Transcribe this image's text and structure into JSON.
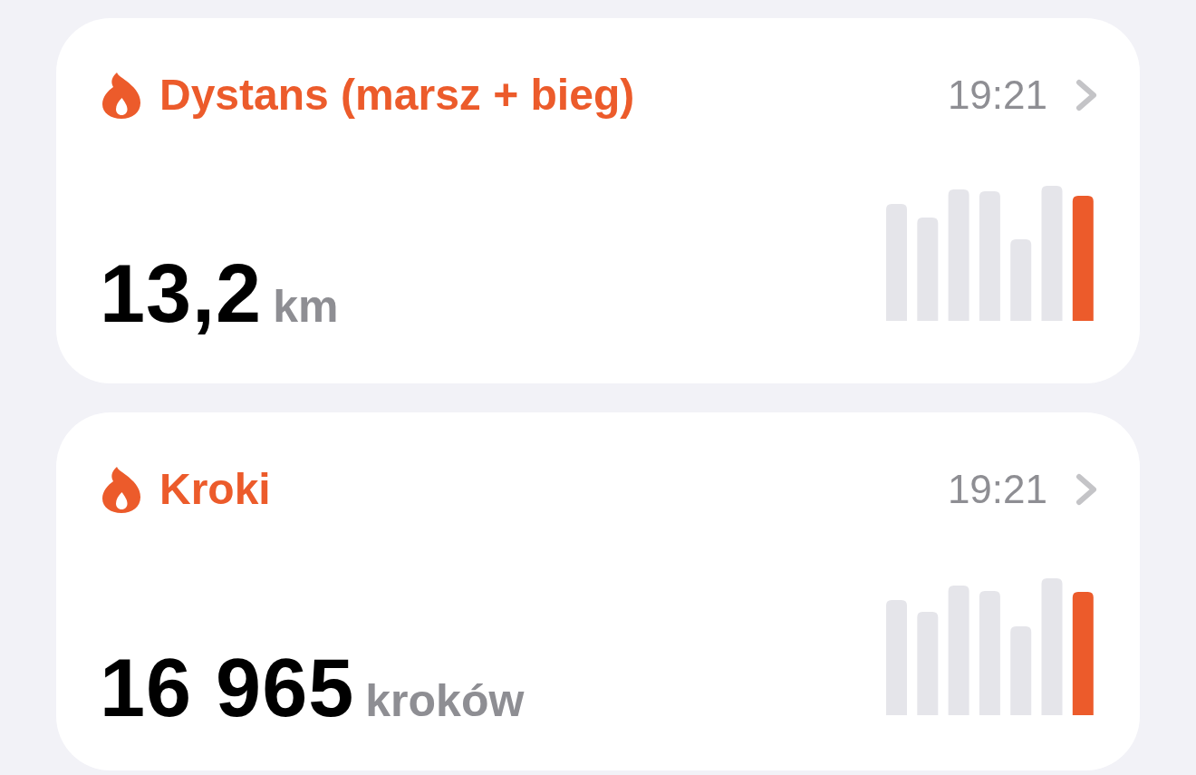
{
  "cards": [
    {
      "title": "Dystans (marsz + bieg)",
      "time": "19:21",
      "value": "13,2",
      "unit": "km"
    },
    {
      "title": "Kroki",
      "time": "19:21",
      "value": "16 965",
      "unit": "kroków"
    }
  ]
}
